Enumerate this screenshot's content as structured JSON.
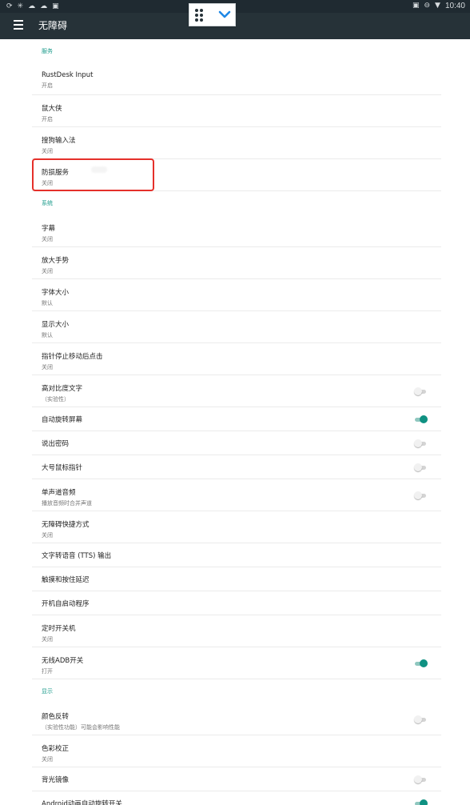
{
  "status_bar": {
    "time": "10:40"
  },
  "toolbar": {
    "title": "无障碍"
  },
  "sections": [
    {
      "header": "服务",
      "items": [
        {
          "title": "RustDesk Input",
          "summary": "开启"
        },
        {
          "title": "鼠大侠",
          "summary": "开启"
        },
        {
          "title": "搜狗输入法",
          "summary": "关闭"
        },
        {
          "title": "防损服务",
          "summary": "关闭"
        }
      ]
    },
    {
      "header": "系统",
      "items": [
        {
          "title": "字幕",
          "summary": "关闭"
        },
        {
          "title": "放大手势",
          "summary": "关闭"
        },
        {
          "title": "字体大小",
          "summary": "默认"
        },
        {
          "title": "显示大小",
          "summary": "默认"
        },
        {
          "title": "指针停止移动后点击",
          "summary": "关闭"
        },
        {
          "title": "高对比度文字",
          "summary": "（实验性）",
          "toggle": "off"
        },
        {
          "title": "自动旋转屏幕",
          "toggle": "on"
        },
        {
          "title": "说出密码",
          "toggle": "off"
        },
        {
          "title": "大号鼠标指针",
          "toggle": "off"
        },
        {
          "title": "单声道音频",
          "summary": "播放音频时合并声道",
          "toggle": "off"
        },
        {
          "title": "无障碍快捷方式",
          "summary": "关闭"
        },
        {
          "title": "文字转语音 (TTS) 输出"
        },
        {
          "title": "触摸和按住延迟"
        },
        {
          "title": "开机自启动程序"
        },
        {
          "title": "定时开关机",
          "summary": "关闭"
        },
        {
          "title": "无线ADB开关",
          "summary": "打开",
          "toggle": "on"
        }
      ]
    },
    {
      "header": "显示",
      "items": [
        {
          "title": "颜色反转",
          "summary": "（实验性功能）可能会影响性能",
          "toggle": "off"
        },
        {
          "title": "色彩校正",
          "summary": "关闭"
        },
        {
          "title": "背光镜像",
          "toggle": "off"
        },
        {
          "title": "Android动画自动旋转开关",
          "toggle": "on"
        }
      ]
    }
  ],
  "colors": {
    "toolbar": "#263238",
    "accent": "#0f9182",
    "highlight": "#e5302a"
  }
}
